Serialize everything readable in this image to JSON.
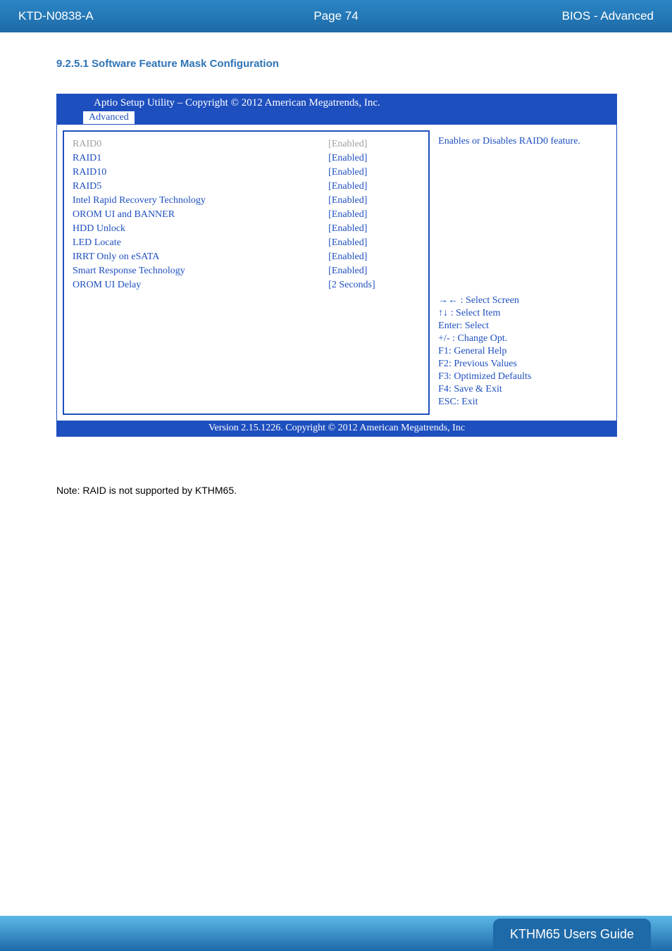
{
  "header": {
    "doc_id": "KTD-N0838-A",
    "page_label": "Page 74",
    "section": "BIOS - Advanced"
  },
  "heading": "9.2.5.1   Software Feature Mask Configuration",
  "bios": {
    "title": "Aptio Setup Utility  –  Copyright © 2012 American Megatrends, Inc.",
    "tab": "Advanced",
    "settings": [
      {
        "label": "RAID0",
        "value": "[Enabled]",
        "selected": true
      },
      {
        "label": "RAID1",
        "value": "[Enabled]",
        "selected": false
      },
      {
        "label": "RAID10",
        "value": "[Enabled]",
        "selected": false
      },
      {
        "label": "RAID5",
        "value": "[Enabled]",
        "selected": false
      },
      {
        "label": "Intel Rapid Recovery Technology",
        "value": "[Enabled]",
        "selected": false
      },
      {
        "label": "OROM UI and BANNER",
        "value": "[Enabled]",
        "selected": false
      },
      {
        "label": "HDD Unlock",
        "value": "[Enabled]",
        "selected": false
      },
      {
        "label": "LED Locate",
        "value": "[Enabled]",
        "selected": false
      },
      {
        "label": "IRRT Only on eSATA",
        "value": "[Enabled]",
        "selected": false
      },
      {
        "label": "Smart Response Technology",
        "value": "[Enabled]",
        "selected": false
      },
      {
        "label": "OROM UI Delay",
        "value": "[2 Seconds]",
        "selected": false
      }
    ],
    "help_text": "Enables or Disables RAID0 feature.",
    "keys": [
      "→← : Select Screen",
      "↑↓ : Select Item",
      "Enter: Select",
      "+/- : Change Opt.",
      "F1: General Help",
      "F2: Previous Values",
      "F3: Optimized Defaults",
      "F4: Save & Exit",
      "ESC: Exit"
    ],
    "footer": "Version 2.15.1226. Copyright © 2012 American Megatrends, Inc"
  },
  "note": "Note: RAID is not supported by KTHM65.",
  "footer_pill": "KTHM65 Users Guide"
}
